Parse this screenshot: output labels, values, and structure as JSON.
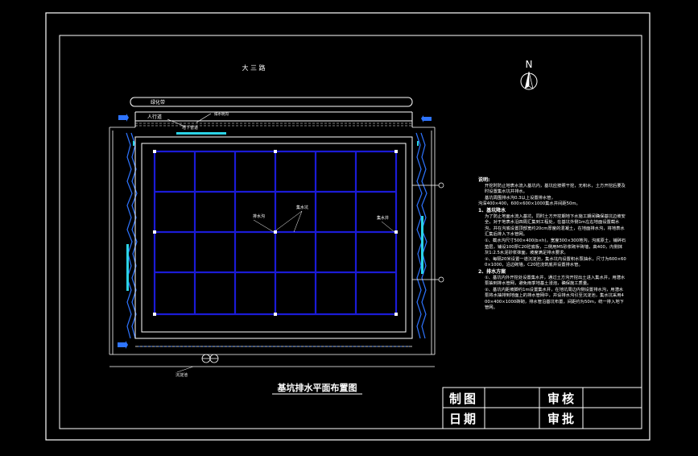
{
  "header": {
    "road_name": "大  三  路"
  },
  "labels": {
    "greenbelt": "绿化带",
    "sidewalk": "人行道",
    "drain_ditch": "排水明沟",
    "underground_pipe": "地下管道",
    "sump_pit": "集水坑",
    "drain_channel": "排水沟",
    "sump_well": "集水井",
    "outlet": "排出口",
    "sediment_tank": "沉淀池",
    "drawing_title": "基坑排水平面布置图",
    "north": "N"
  },
  "notes": {
    "title": "说明:",
    "lines": [
      "开挖时防止地表水流入基坑内，基坑应按照干挖，无积水，土方开挖后要及时设置集水坑并排水。",
      "基坑周围排水沟0.3以上设置排水管，",
      "沟深400×400，600×600×1000集水井间距50m。",
      "1、基坑降水",
      "为了防止地面水流入基坑，同时土方开挖期地下水施工期间确保基坑边坡安全，对于地表水沿四周汇集到工程处，在基坑外侧1m左右地面设置截水沟，并在沟底设置顶部宽约20cm厚度的混凝土，在地面排水沟，将地表水汇集后排入下水管网。",
      "①、截水沟尺寸500×400(b×h)，宽度300×300地沟，沟底原土，铺碎石垫层，铺设100厚C20砼底板，二侧用M5砂浆砌半砖墙，高400，内侧抹灰1:2.5水泥砂浆抹面，坡度满足排水要求。",
      "②、每隔20米设置一道沉淀池，集水坑内设置积水泵抽水，尺寸为600×600×1000，沿边砌墙，C20砼浇筑底并设置排水管。",
      "2、排水方案",
      "①、基坑内外开挖处设置集水井，通过土方沟开挖出土进入集水井，用潜水泵抽到排水管网，避免雨季地基土浸泡，确保施工质量。",
      "②、基坑内距坡脚约1m设置集水井，在地坑周边内侧设置排水沟，用潜水泵将水抽排到地面上的排水管网中，并设排水沟引至沉淀池，集水坑采用400×400×1000砖砌，排水管沿基坑布置，间距约为50m，统一排入地下管网。"
    ]
  },
  "title_block": {
    "drawn": "制图",
    "checked": "审核",
    "date": "日期",
    "approved": "审批"
  },
  "colors": {
    "background": "#000000",
    "line": "#ffffff",
    "grid": "#1b1bd6",
    "wall": "#2e74ff",
    "water": "#2bd3e6"
  }
}
